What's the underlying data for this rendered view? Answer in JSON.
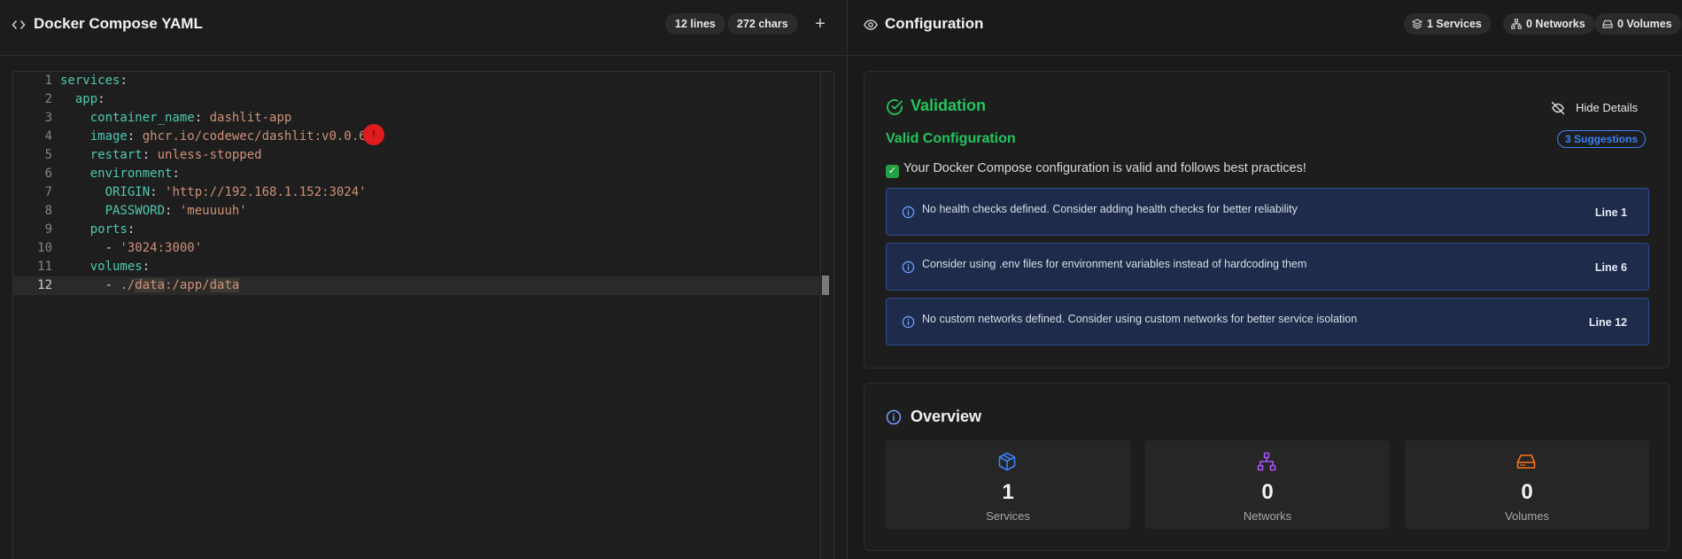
{
  "editor_panel": {
    "title": "Docker Compose YAML",
    "lines_badge": "12 lines",
    "chars_badge": "272 chars",
    "add_label": "+"
  },
  "editor": {
    "current_line": 12,
    "error_marker": "!",
    "lines": [
      {
        "n": "1",
        "tokens": [
          [
            "k",
            "services"
          ],
          [
            "p",
            ":"
          ]
        ]
      },
      {
        "n": "2",
        "tokens": [
          [
            "p",
            "  "
          ],
          [
            "k",
            "app"
          ],
          [
            "p",
            ":"
          ]
        ]
      },
      {
        "n": "3",
        "tokens": [
          [
            "p",
            "    "
          ],
          [
            "k",
            "container_name"
          ],
          [
            "p",
            ": "
          ],
          [
            "s",
            "dashlit-app"
          ]
        ]
      },
      {
        "n": "4",
        "tokens": [
          [
            "p",
            "    "
          ],
          [
            "k",
            "image"
          ],
          [
            "p",
            ": "
          ],
          [
            "s",
            "ghcr.io/codewec/dashlit:v0.0.6"
          ]
        ]
      },
      {
        "n": "5",
        "tokens": [
          [
            "p",
            "    "
          ],
          [
            "k",
            "restart"
          ],
          [
            "p",
            ": "
          ],
          [
            "s",
            "unless-stopped"
          ]
        ]
      },
      {
        "n": "6",
        "tokens": [
          [
            "p",
            "    "
          ],
          [
            "k",
            "environment"
          ],
          [
            "p",
            ":"
          ]
        ]
      },
      {
        "n": "7",
        "tokens": [
          [
            "p",
            "      "
          ],
          [
            "k",
            "ORIGIN"
          ],
          [
            "p",
            ": "
          ],
          [
            "s",
            "'http://192.168.1.152:3024'"
          ]
        ]
      },
      {
        "n": "8",
        "tokens": [
          [
            "p",
            "      "
          ],
          [
            "k",
            "PASSWORD"
          ],
          [
            "p",
            ": "
          ],
          [
            "s",
            "'meuuuuh'"
          ]
        ]
      },
      {
        "n": "9",
        "tokens": [
          [
            "p",
            "    "
          ],
          [
            "k",
            "ports"
          ],
          [
            "p",
            ":"
          ]
        ]
      },
      {
        "n": "10",
        "tokens": [
          [
            "p",
            "      - "
          ],
          [
            "s",
            "'3024:3000'"
          ]
        ]
      },
      {
        "n": "11",
        "tokens": [
          [
            "p",
            "    "
          ],
          [
            "k",
            "volumes"
          ],
          [
            "p",
            ":"
          ]
        ]
      },
      {
        "n": "12",
        "tokens": [
          [
            "p",
            "      - "
          ],
          [
            "s",
            "./"
          ],
          [
            "sh",
            "data"
          ],
          [
            "s",
            ":/app/"
          ],
          [
            "sh",
            "data"
          ]
        ]
      }
    ]
  },
  "config_panel": {
    "title": "Configuration",
    "badges": {
      "services": "1 Services",
      "networks": "0 Networks",
      "volumes": "0 Volumes"
    }
  },
  "validation": {
    "title": "Validation",
    "hide_label": "Hide Details",
    "status": "Valid Configuration",
    "suggestions_badge": "3 Suggestions",
    "message": "Your Docker Compose configuration is valid and follows best practices!",
    "suggestions": [
      {
        "text": "No health checks defined. Consider adding health checks for better reliability",
        "line": "Line 1"
      },
      {
        "text": "Consider using .env files for environment variables instead of hardcoding them",
        "line": "Line 6"
      },
      {
        "text": "No custom networks defined. Consider using custom networks for better service isolation",
        "line": "Line 12"
      }
    ]
  },
  "overview": {
    "title": "Overview",
    "stats": [
      {
        "value": "1",
        "label": "Services",
        "icon": "box-icon",
        "color": "#3b82f6"
      },
      {
        "value": "0",
        "label": "Networks",
        "icon": "network-icon",
        "color": "#a855f7"
      },
      {
        "value": "0",
        "label": "Volumes",
        "icon": "hard-drive-icon",
        "color": "#f97316"
      }
    ]
  },
  "colors": {
    "success": "#22c55e",
    "info": "#3b82f6",
    "key": "#4ec9b0",
    "string": "#ce9178"
  }
}
